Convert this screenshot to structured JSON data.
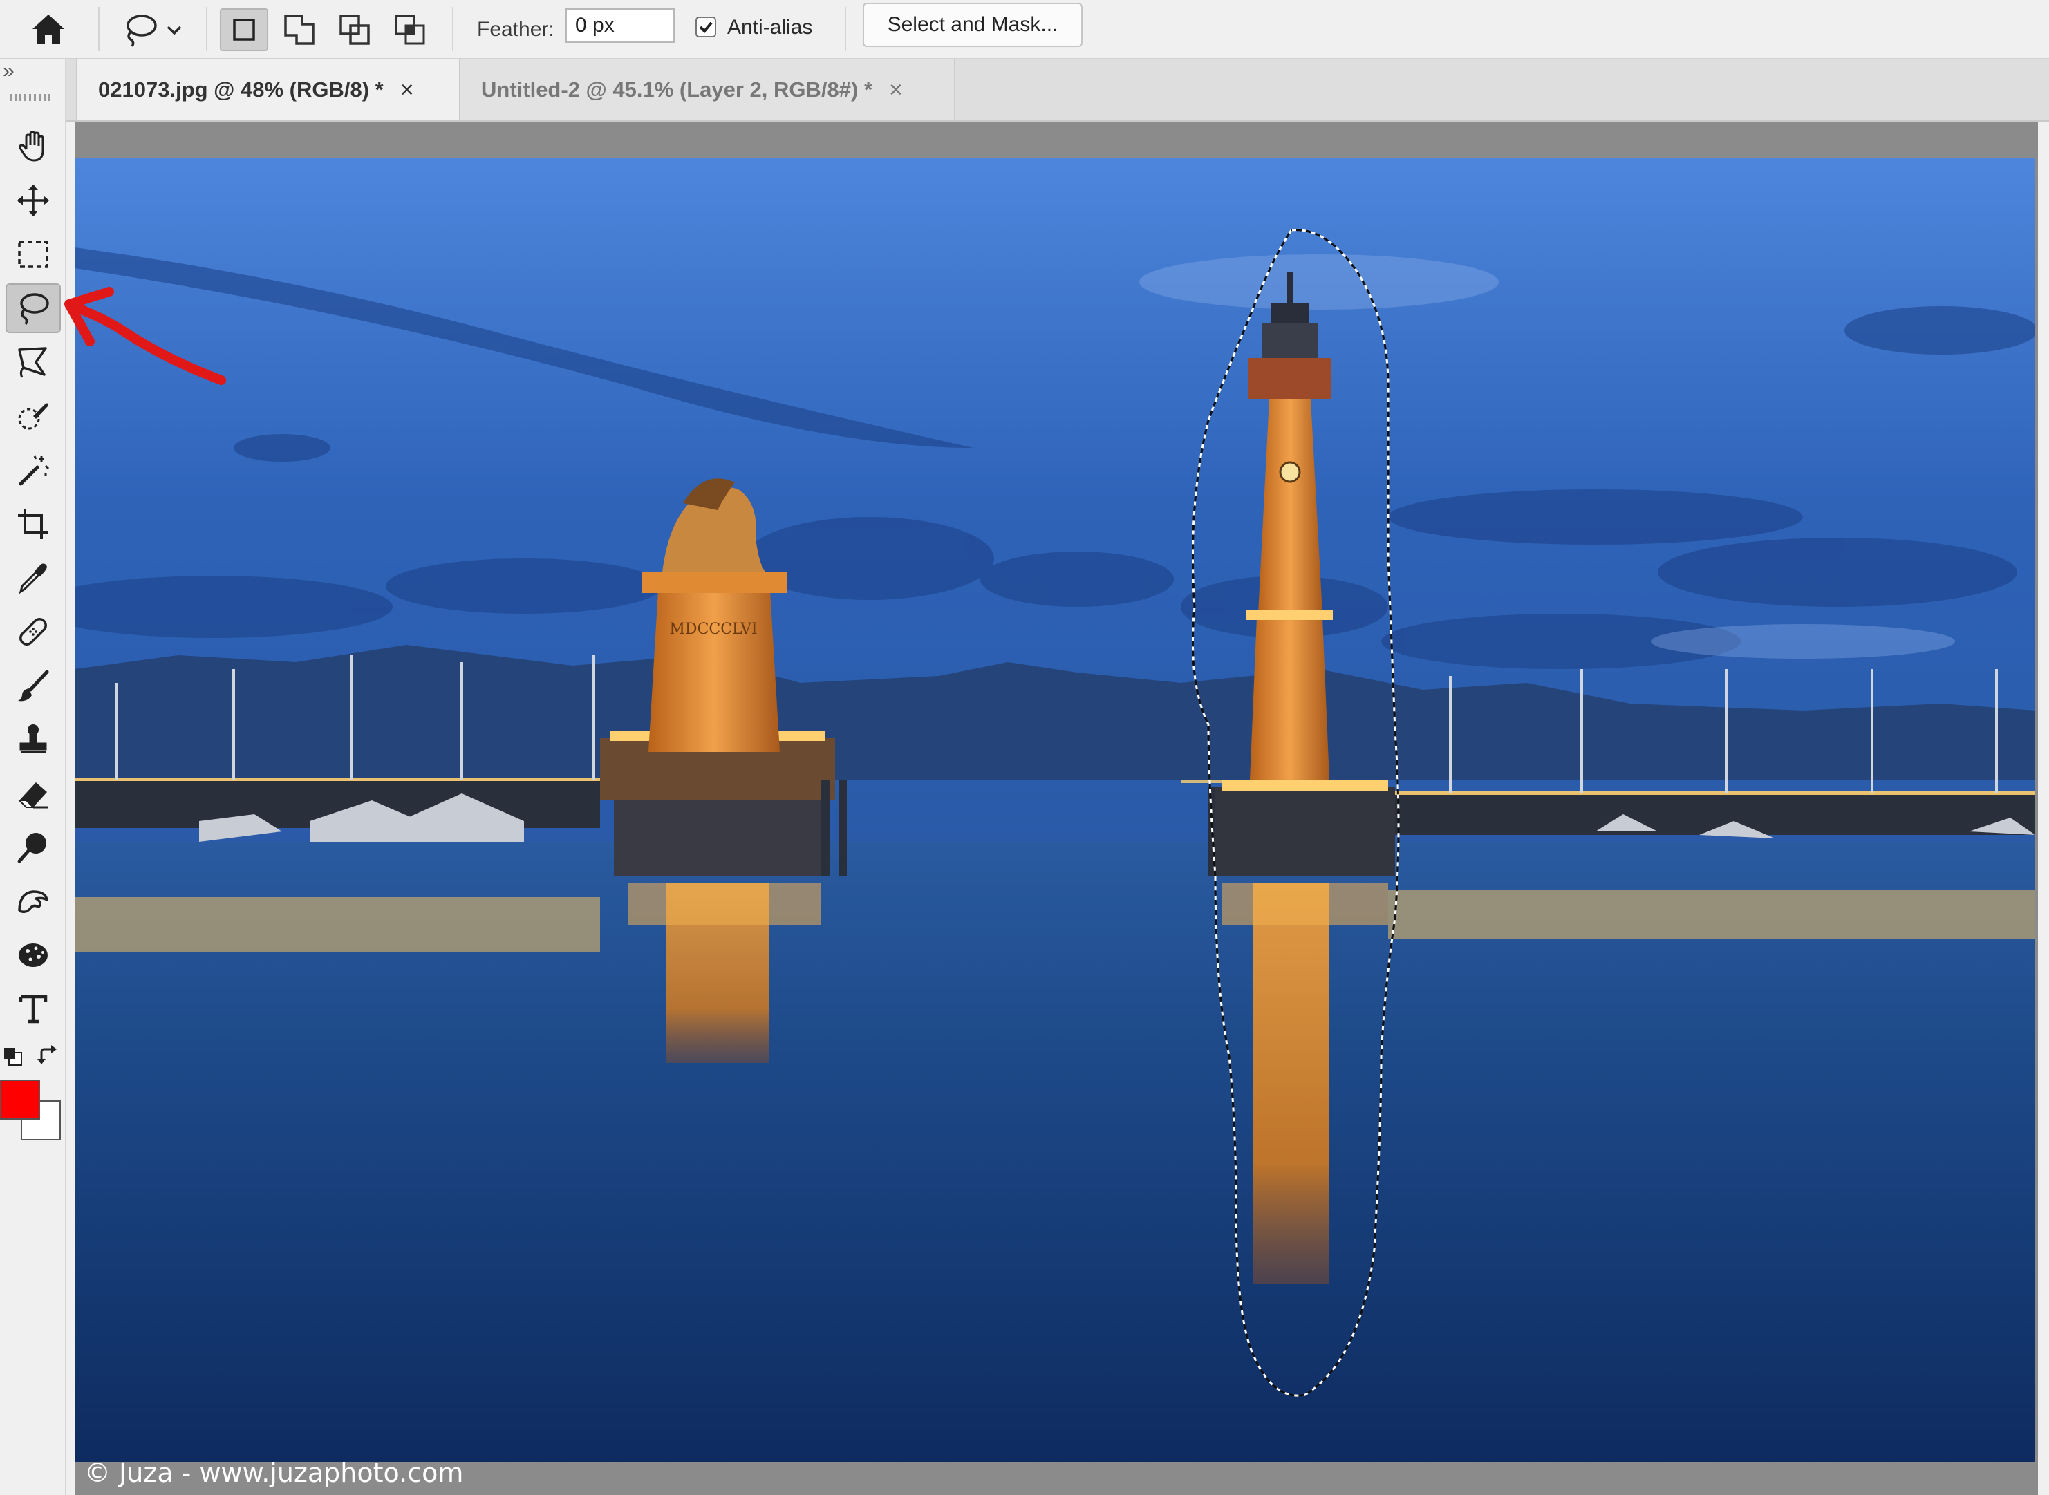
{
  "options_bar": {
    "home_icon": "home-icon",
    "lasso_icon": "lasso-icon",
    "selection_modes": [
      "new-selection-icon",
      "add-to-selection-icon",
      "subtract-from-selection-icon",
      "intersect-selection-icon"
    ],
    "feather_label": "Feather:",
    "feather_value": "0 px",
    "anti_alias_label": "Anti-alias",
    "anti_alias_checked": true,
    "select_and_mask_label": "Select and Mask..."
  },
  "toolbar": {
    "collapse_glyph": "»",
    "active_tool": "lasso",
    "foreground_color": "#ff0000",
    "background_color": "#ffffff",
    "tools": [
      "hand-icon",
      "move-icon",
      "marquee-icon",
      "lasso-icon",
      "polygonal-lasso-icon",
      "quick-selection-icon",
      "magic-wand-icon",
      "crop-icon",
      "eyedropper-icon",
      "healing-icon",
      "brush-icon",
      "clone-stamp-icon",
      "eraser-icon",
      "dodge-icon",
      "smudge-icon",
      "sponge-icon",
      "type-icon"
    ]
  },
  "tabs": [
    {
      "title": "021073.jpg @ 48% (RGB/8) *",
      "close": "×",
      "active": true
    },
    {
      "title": "Untitled-2 @ 45.1% (Layer 2, RGB/8#) *",
      "close": "×",
      "active": false
    }
  ],
  "canvas": {
    "credit": "© Juza - www.juzaphoto.com",
    "annotation_color": "#e01818",
    "lion_inscription": "MDCCCLVI"
  }
}
